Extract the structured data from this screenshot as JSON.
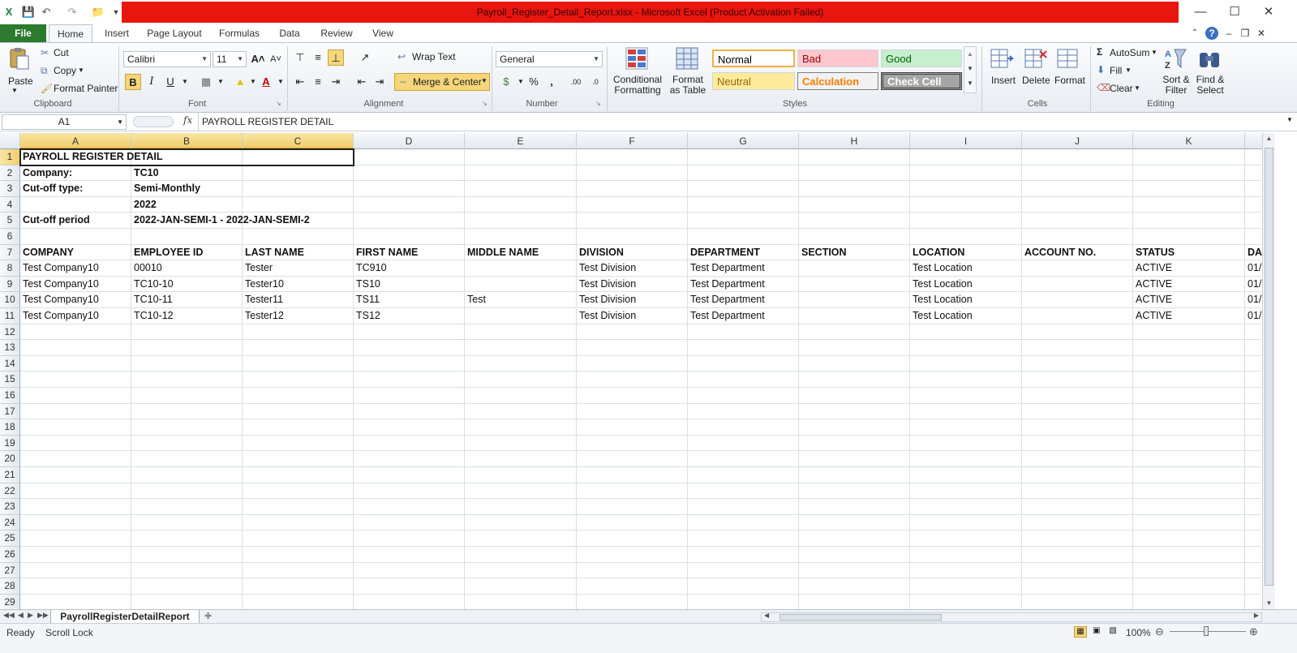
{
  "window": {
    "title": "Payroll_Register_Detail_Report.xlsx  -  Microsoft Excel (Product Activation Failed)"
  },
  "tabs": [
    "File",
    "Home",
    "Insert",
    "Page Layout",
    "Formulas",
    "Data",
    "Review",
    "View"
  ],
  "ribbon": {
    "clipboard": {
      "label": "Clipboard",
      "paste": "Paste",
      "cut": "Cut",
      "copy": "Copy",
      "format_painter": "Format Painter"
    },
    "font": {
      "label": "Font",
      "name": "Calibri",
      "size": "11"
    },
    "alignment": {
      "label": "Alignment",
      "wrap_text": "Wrap Text",
      "merge_center": "Merge & Center"
    },
    "number": {
      "label": "Number",
      "format": "General"
    },
    "styles": {
      "label": "Styles",
      "conditional_formatting": "Conditional Formatting",
      "format_as_table": "Format as Table",
      "normal": "Normal",
      "bad": "Bad",
      "good": "Good",
      "neutral": "Neutral",
      "calculation": "Calculation",
      "check_cell": "Check Cell"
    },
    "cells": {
      "label": "Cells",
      "insert": "Insert",
      "delete": "Delete",
      "format": "Format"
    },
    "editing": {
      "label": "Editing",
      "autosum": "AutoSum",
      "fill": "Fill",
      "clear": "Clear",
      "sort_filter": "Sort & Filter",
      "find_select": "Find & Select"
    }
  },
  "formula_bar": {
    "name_box": "A1",
    "fx": "fx",
    "content": "PAYROLL REGISTER DETAIL"
  },
  "columns": [
    "A",
    "B",
    "C",
    "D",
    "E",
    "F",
    "G",
    "H",
    "I",
    "J",
    "K"
  ],
  "rows": [
    "1",
    "2",
    "3",
    "4",
    "5",
    "6",
    "7",
    "8",
    "9",
    "10",
    "11",
    "12",
    "13",
    "14",
    "15",
    "16",
    "17",
    "18",
    "19",
    "20",
    "21",
    "22",
    "23",
    "24",
    "25",
    "26",
    "27",
    "28",
    "29"
  ],
  "sheet": {
    "r1": {
      "a": "PAYROLL REGISTER DETAIL"
    },
    "r2": {
      "a": "Company:",
      "b": "TC10"
    },
    "r3": {
      "a": "Cut-off type:",
      "b": "Semi-Monthly"
    },
    "r4": {
      "b": "2022"
    },
    "r5": {
      "a": "Cut-off period",
      "b": "2022-JAN-SEMI-1 - 2022-JAN-SEMI-2"
    },
    "headers": [
      "COMPANY",
      "EMPLOYEE ID",
      "LAST NAME",
      "FIRST NAME",
      "MIDDLE NAME",
      "DIVISION",
      "DEPARTMENT",
      "SECTION",
      "LOCATION",
      "ACCOUNT NO.",
      "STATUS",
      "DA"
    ],
    "data": [
      [
        "Test Company10",
        "00010",
        "Tester",
        "TC910",
        "",
        "Test Division",
        "Test Department",
        "",
        "Test Location",
        "",
        "ACTIVE",
        "01/"
      ],
      [
        "Test Company10",
        "TC10-10",
        "Tester10",
        "TS10",
        "",
        "Test Division",
        "Test Department",
        "",
        "Test Location",
        "",
        "ACTIVE",
        "01/"
      ],
      [
        "Test Company10",
        "TC10-11",
        "Tester11",
        "TS11",
        "Test",
        "Test Division",
        "Test Department",
        "",
        "Test Location",
        "",
        "ACTIVE",
        "01/"
      ],
      [
        "Test Company10",
        "TC10-12",
        "Tester12",
        "TS12",
        "",
        "Test Division",
        "Test Department",
        "",
        "Test Location",
        "",
        "ACTIVE",
        "01/"
      ]
    ]
  },
  "sheet_tab": "PayrollRegisterDetailReport",
  "status": {
    "ready": "Ready",
    "scroll_lock": "Scroll Lock",
    "zoom": "100%"
  }
}
